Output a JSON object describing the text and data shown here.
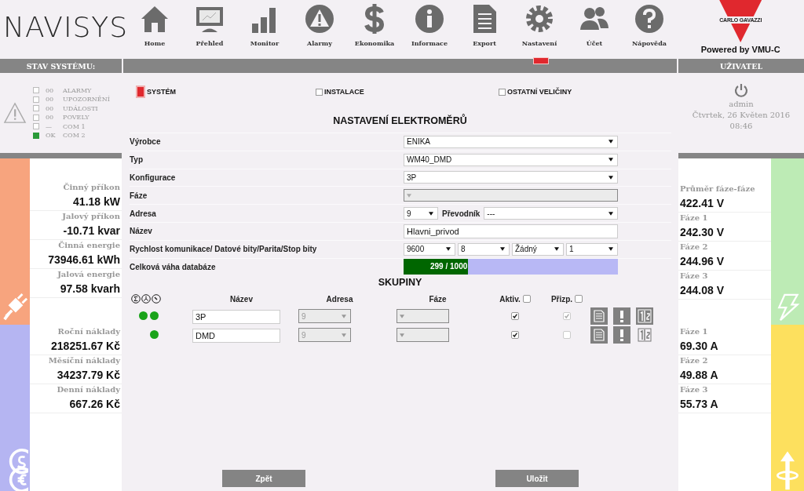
{
  "logo": {
    "text": "NAVISYS"
  },
  "nav": [
    {
      "label": "Home",
      "kind": "home",
      "selected": false
    },
    {
      "label": "Přehled",
      "kind": "monitor",
      "selected": false
    },
    {
      "label": "Monitor",
      "kind": "bars",
      "selected": false
    },
    {
      "label": "Alarmy",
      "kind": "warning",
      "selected": false
    },
    {
      "label": "Ekonomika",
      "kind": "dollar",
      "selected": false
    },
    {
      "label": "Informace",
      "kind": "info",
      "selected": false
    },
    {
      "label": "Export",
      "kind": "document",
      "selected": false
    },
    {
      "label": "Nastavení",
      "kind": "gear",
      "selected": true
    },
    {
      "label": "Účet",
      "kind": "users",
      "selected": false
    },
    {
      "label": "Nápověda",
      "kind": "help",
      "selected": false
    }
  ],
  "brand": {
    "name": "CARLO GAVAZZI",
    "powered": "Powered by  VMU-C"
  },
  "status": {
    "title": "STAV SYSTÉMU:",
    "items": [
      {
        "on": false,
        "count": "00",
        "label": "ALARMY"
      },
      {
        "on": false,
        "count": "00",
        "label": "UPOZORNĚNÍ"
      },
      {
        "on": false,
        "count": "00",
        "label": "UDÁLOSTI"
      },
      {
        "on": false,
        "count": "00",
        "label": "POVELY"
      },
      {
        "on": false,
        "count": "—",
        "label": "COM 1"
      },
      {
        "on": true,
        "count": "OK",
        "label": "COM 2"
      }
    ]
  },
  "user": {
    "title": "UŽIVATEL",
    "name": "admin",
    "date": "Čtvrtek, 26 Květen 2016",
    "time": "08:46"
  },
  "tabs": [
    {
      "label": "SYSTÉM",
      "selected": true
    },
    {
      "label": "INSTALACE",
      "selected": false
    },
    {
      "label": "OSTATNÍ VELIČINY",
      "selected": false
    }
  ],
  "form": {
    "title": "NASTAVENÍ ELEKTROMĚRŮ",
    "rows": [
      {
        "kind": "select",
        "label": "Výrobce",
        "value": "ENIKA",
        "disabled": false
      },
      {
        "kind": "select",
        "label": "Typ",
        "value": "WM40_DMD",
        "disabled": false
      },
      {
        "kind": "select",
        "label": "Konfigurace",
        "value": "3P",
        "disabled": false
      },
      {
        "kind": "select",
        "label": "Fáze",
        "disabled": true
      },
      {
        "kind": "address",
        "label": "Adresa",
        "value": "9",
        "sublabel": "Převodník",
        "subvalue": "---"
      },
      {
        "kind": "text",
        "label": "Název",
        "value": "Hlavni_privod"
      },
      {
        "kind": "multi",
        "label": "Rychlost komunikace/ Datové bity/Parita/Stop bity",
        "values": [
          "9600",
          "8",
          "Žádný",
          "1"
        ]
      },
      {
        "kind": "progress",
        "label": "Celková váha databáze",
        "level": 0.299,
        "reading": "299 / 1000"
      }
    ]
  },
  "groups": {
    "title": "SKUPINY",
    "columns": [
      "Název",
      "Adresa",
      "Fáze",
      "Aktiv.",
      "Přizp."
    ],
    "all_active": false,
    "all_adjusted": false,
    "rows": [
      {
        "dots": [
          true,
          true
        ],
        "name": "3P",
        "address": "9",
        "active": true,
        "adjusted": true,
        "swap_enabled": true
      },
      {
        "dots": [
          false,
          true
        ],
        "name": "DMD",
        "address": "9",
        "active": true,
        "adjusted": false,
        "swap_enabled": false
      }
    ]
  },
  "left_sections": [
    {
      "color": "#f7a47e",
      "kind": "plug",
      "metrics": [
        {
          "label": "Činný příkon",
          "value": "41.18 kW"
        },
        {
          "label": "Jalový příkon",
          "value": "-10.71 kvar"
        },
        {
          "label": "Činná energie",
          "value": "73946.61 kWh"
        },
        {
          "label": "Jalová energie",
          "value": "97.58 kvarh"
        }
      ]
    },
    {
      "color": "#b5b5f2",
      "kind": "coins",
      "metrics": [
        {
          "label": "Roční náklady",
          "value": "218251.67 Kč"
        },
        {
          "label": "Měsíční náklady",
          "value": "34237.79 Kč"
        },
        {
          "label": "Denní náklady",
          "value": "667.26 Kč"
        }
      ]
    }
  ],
  "right_sections": [
    {
      "color": "#bdebb5",
      "kind": "bolt",
      "metrics": [
        {
          "label": "Průměr fáze-fáze",
          "value": "422.41 V"
        },
        {
          "label": "Fáze 1",
          "value": "242.30 V"
        },
        {
          "label": "Fáze 2",
          "value": "244.96 V"
        },
        {
          "label": "Fáze 3",
          "value": "244.08 V"
        }
      ]
    },
    {
      "color": "#fde05e",
      "kind": "current",
      "metrics": [
        {
          "label": "Fáze 1",
          "value": "69.30 A"
        },
        {
          "label": "Fáze 2",
          "value": "49.88 A"
        },
        {
          "label": "Fáze 3",
          "value": "55.73 A"
        }
      ]
    }
  ],
  "buttons": [
    "Zpět",
    "Uložit"
  ]
}
